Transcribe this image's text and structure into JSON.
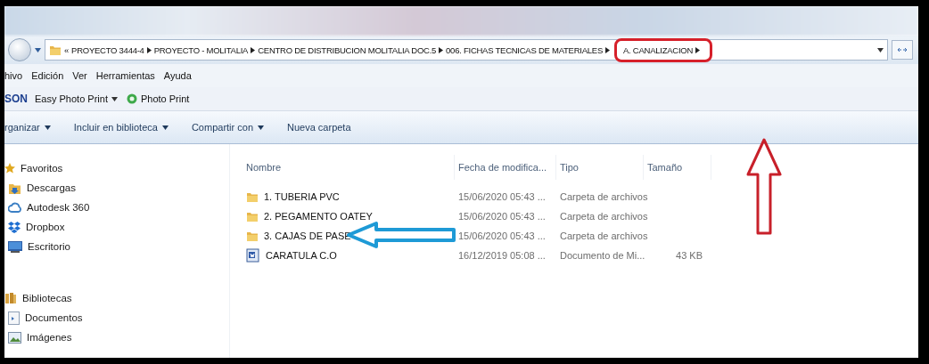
{
  "address_bar": {
    "overflow": "«",
    "crumbs": [
      "PROYECTO 3444-4",
      "PROYECTO - MOLITALIA",
      "CENTRO DE DISTRIBUCION MOLITALIA DOC.5",
      "006. FICHAS TECNICAS DE MATERIALES",
      "A. CANALIZACION"
    ]
  },
  "menu": [
    "hivo",
    "Edición",
    "Ver",
    "Herramientas",
    "Ayuda"
  ],
  "epson_bar": {
    "brand": "SON",
    "items": [
      {
        "label": "Easy Photo Print",
        "kind": "dropdown"
      },
      {
        "label": "Photo Print",
        "kind": "launcher"
      }
    ]
  },
  "commands": [
    {
      "label": "rganizar",
      "dropdown": true
    },
    {
      "label": "Incluir en biblioteca",
      "dropdown": true
    },
    {
      "label": "Compartir con",
      "dropdown": true
    },
    {
      "label": "Nueva carpeta",
      "dropdown": false
    }
  ],
  "sidebar": [
    {
      "title": "Favoritos",
      "items": [
        "Descargas",
        "Autodesk 360",
        "Dropbox",
        "Escritorio"
      ]
    },
    {
      "title": "Bibliotecas",
      "items": [
        "Documentos",
        "Imágenes"
      ]
    }
  ],
  "file_list": {
    "columns": [
      "Nombre",
      "Fecha de modifica...",
      "Tipo",
      "Tamaño"
    ],
    "rows": [
      {
        "kind": "folder",
        "name": "1. TUBERIA PVC",
        "date": "15/06/2020 05:43 ...",
        "type": "Carpeta de archivos"
      },
      {
        "kind": "folder",
        "name": "2. PEGAMENTO OATEY",
        "date": "15/06/2020 05:43 ...",
        "type": "Carpeta de archivos"
      },
      {
        "kind": "folder",
        "name": "3. CAJAS DE PASE",
        "date": "15/06/2020 05:43 ...",
        "type": "Carpeta de archivos"
      },
      {
        "kind": "document",
        "name": "CARATULA C.O",
        "date": "16/12/2019 05:08 ...",
        "type": "Documento de Mi...",
        "size": "43 KB"
      }
    ]
  }
}
